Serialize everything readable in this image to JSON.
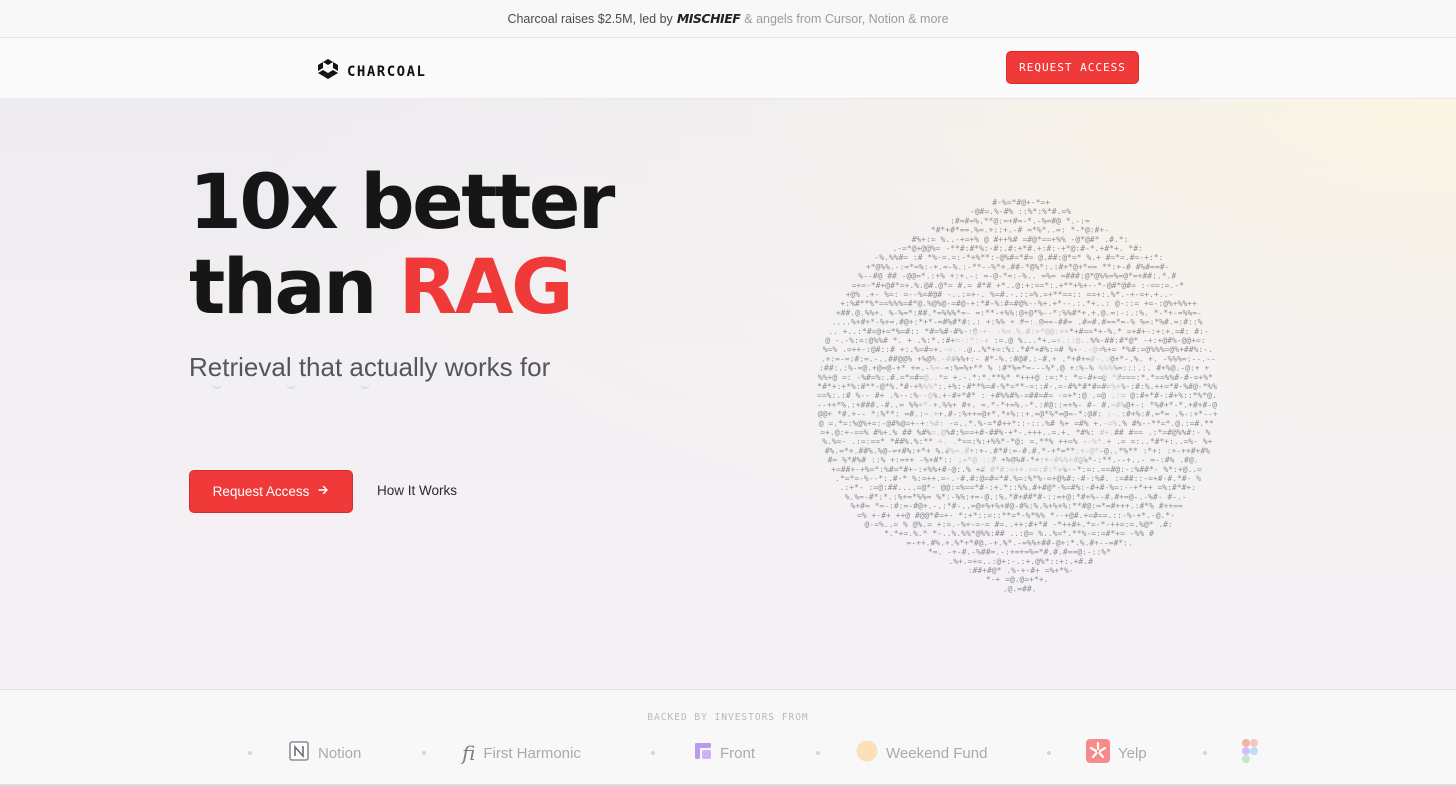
{
  "announcement": {
    "prefix": "Charcoal raises $2.5M, led by",
    "lead_investor": "MISCHIEF",
    "suffix": "& angels from Cursor, Notion & more"
  },
  "nav": {
    "brand": "CHARCOAL",
    "cta": "REQUEST ACCESS"
  },
  "hero": {
    "headline_line1": "10x better",
    "headline_line2_prefix": "than ",
    "headline_line2_accent": "RAG",
    "subheadline": "Retrieval that actually works for",
    "primary_cta": "Request Access",
    "primary_cta_icon": "arrow-right-icon",
    "secondary_cta": "How It Works",
    "illustration": "ascii-brain-art"
  },
  "investors": {
    "title": "BACKED BY INVESTORS FROM",
    "items": [
      {
        "name": "Notion",
        "icon": "notion-icon"
      },
      {
        "name": "First Harmonic",
        "icon": "first-harmonic-icon"
      },
      {
        "name": "Front",
        "icon": "front-icon"
      },
      {
        "name": "Weekend Fund",
        "icon": "weekend-fund-icon"
      },
      {
        "name": "Yelp",
        "icon": "yelp-icon"
      },
      {
        "name": "",
        "icon": "figma-icon"
      }
    ]
  },
  "colors": {
    "accent": "#f03a3a",
    "text": "#161616",
    "muted": "#9a9aa3"
  }
}
